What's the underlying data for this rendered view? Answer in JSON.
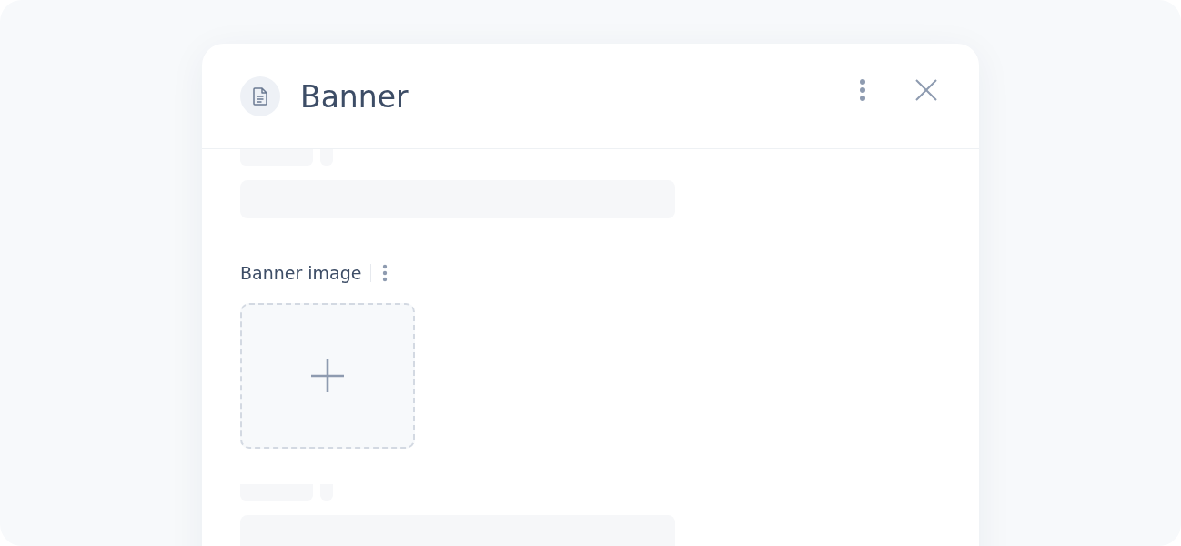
{
  "panel": {
    "title": "Banner"
  },
  "fields": [
    {
      "kind": "skeleton"
    },
    {
      "kind": "image",
      "label": "Banner image"
    },
    {
      "kind": "skeleton"
    }
  ]
}
